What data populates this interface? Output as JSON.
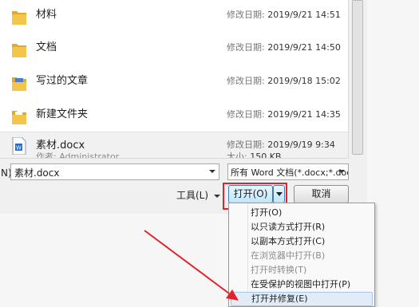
{
  "files": [
    {
      "name": "材料",
      "meta_label": "修改日期:",
      "meta_value": "2019/9/21 14:51"
    },
    {
      "name": "文档",
      "meta_label": "修改日期:",
      "meta_value": "2019/9/21 14:50"
    },
    {
      "name": "写过的文章",
      "meta_label": "修改日期:",
      "meta_value": "2019/9/18 15:02"
    },
    {
      "name": "新建文件夹",
      "meta_label": "修改日期:",
      "meta_value": "2019/9/21 14:35"
    },
    {
      "name": "素材.docx",
      "sub_label": "作者:",
      "sub_value": "Administrator",
      "meta_label": "修改日期:",
      "meta_value": "2019/9/19 9:34",
      "meta2_label": "大小:",
      "meta2_value": "150 KB"
    }
  ],
  "filename_label": "N):",
  "filename_value": "素材.docx",
  "filetype_value": "所有 Word 文档(*.docx;*.doc",
  "tools_label": "工具(L)",
  "open_label": "打开(O)",
  "cancel_label": "取消",
  "menu": [
    {
      "label": "打开(O)",
      "disabled": false
    },
    {
      "label": "以只读方式打开(R)",
      "disabled": false
    },
    {
      "label": "以副本方式打开(C)",
      "disabled": false
    },
    {
      "label": "在浏览器中打开(B)",
      "disabled": true
    },
    {
      "label": "打开时转换(T)",
      "disabled": true
    },
    {
      "label": "在受保护的视图中打开(P)",
      "disabled": false
    },
    {
      "label": "打开并修复(E)",
      "disabled": false
    }
  ],
  "colors": {
    "highlight": "#e0242b",
    "folder": "#f3c54a",
    "word": "#2b6ac4"
  }
}
